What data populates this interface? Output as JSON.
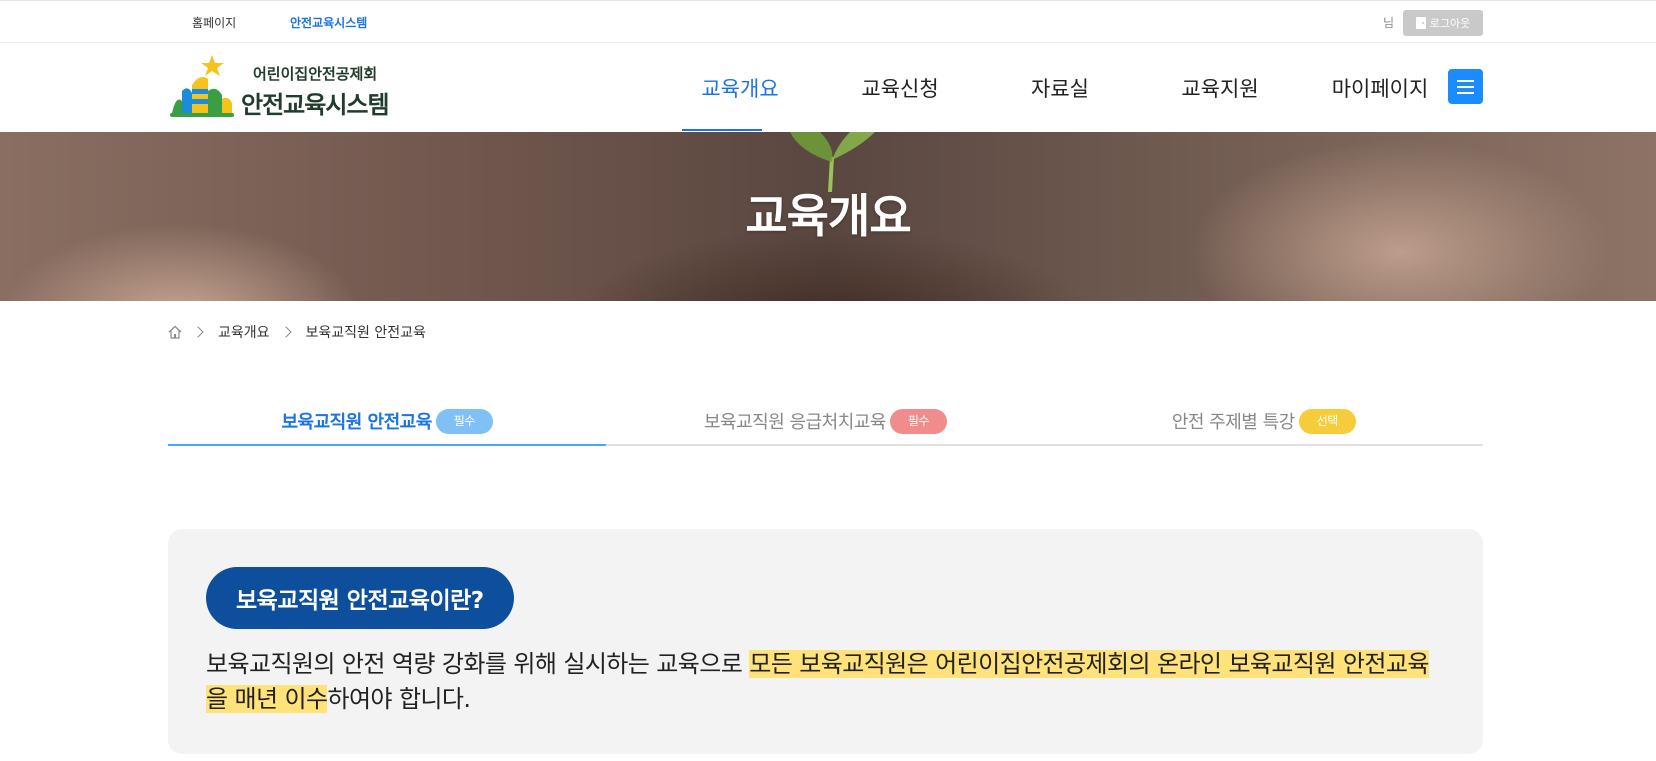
{
  "util_bar": {
    "home_link": "홈페이지",
    "system_link": "안전교육시스템",
    "user_suffix": "님",
    "logout_label": "로그아웃"
  },
  "logo": {
    "org_name": "어린이집안전공제회",
    "system_name": "안전교육시스템"
  },
  "nav": {
    "items": [
      {
        "label": "교육개요",
        "active": true
      },
      {
        "label": "교육신청",
        "active": false
      },
      {
        "label": "자료실",
        "active": false
      },
      {
        "label": "교육지원",
        "active": false
      },
      {
        "label": "마이페이지",
        "active": false
      }
    ]
  },
  "banner": {
    "title": "교육개요"
  },
  "breadcrumb": {
    "items": [
      "교육개요",
      "보육교직원 안전교육"
    ]
  },
  "tabs": [
    {
      "label": "보육교직원 안전교육",
      "badge": "필수",
      "badge_color": "#7fc0f5",
      "active": true
    },
    {
      "label": "보육교직원 응급처치교육",
      "badge": "필수",
      "badge_color": "#f08c8c",
      "active": false
    },
    {
      "label": "안전 주제별 특강",
      "badge": "선택",
      "badge_color": "#f7cc3b",
      "active": false
    }
  ],
  "info": {
    "heading": "보육교직원 안전교육이란?",
    "text_before": "보육교직원의 안전 역량 강화를 위해 실시하는 교육으로 ",
    "text_highlight": "모든 보육교직원은 어린이집안전공제회의 온라인 보육교직원 안전교육을 매년 이수",
    "text_after": "하여야 합니다."
  },
  "colors": {
    "accent": "#1a73e8",
    "heading_bg": "#0d4f9c",
    "highlight": "#ffe27a"
  }
}
